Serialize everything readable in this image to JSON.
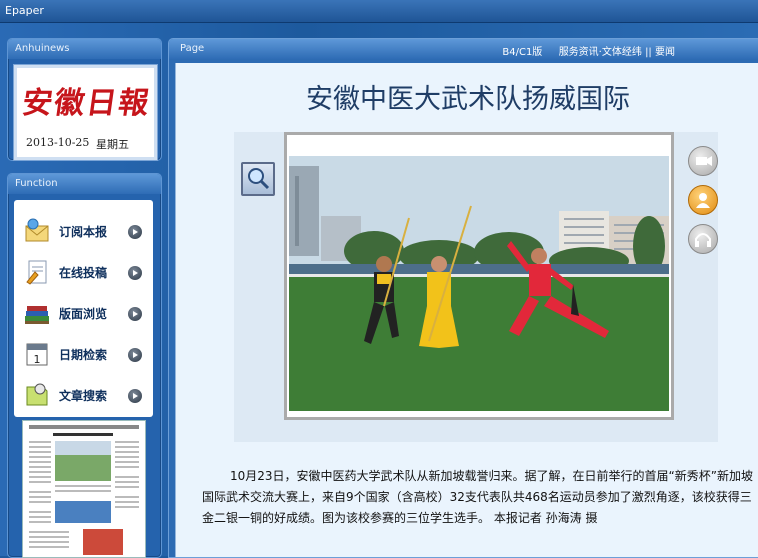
{
  "window": {
    "title": "Epaper"
  },
  "left_panel": {
    "brand": {
      "header": "Anhuinews",
      "logo_text": "安徽日報",
      "date": "2013-10-25",
      "weekday": "星期五"
    },
    "function": {
      "header": "Function",
      "items": [
        {
          "label": "订阅本报",
          "icon": "subscribe-envelope-icon"
        },
        {
          "label": "在线投稿",
          "icon": "submit-document-icon"
        },
        {
          "label": "版面浏览",
          "icon": "browse-books-icon"
        },
        {
          "label": "日期检索",
          "icon": "calendar-icon"
        },
        {
          "label": "文章搜索",
          "icon": "article-search-icon"
        }
      ]
    }
  },
  "page": {
    "header": "Page",
    "nav": {
      "edition": "B4/C1版",
      "section": "服务资讯·文体经纬",
      "separator": "||",
      "home": "要闻"
    },
    "headline": "安徽中医大武术队扬威国际",
    "body": "10月23日，安徽中医药大学武术队从新加坡载誉归来。据了解，在日前举行的首届“新秀杯”新加坡国际武术交流大赛上，来自9个国家（含高校）32支代表队共468名运动员参加了激烈角逐，该校获得三金二银一铜的好成绩。图为该校参赛的三位学生选手。 本报记者 孙海涛 摄"
  },
  "colors": {
    "chrome_blue": "#1d5a9e",
    "logo_red": "#c6151b",
    "headline": "#1f3d66",
    "content_bg": "#eaf4fd"
  }
}
